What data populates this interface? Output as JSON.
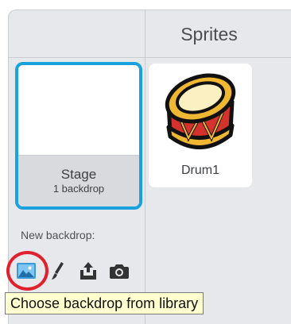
{
  "sprites_panel": {
    "title": "Sprites"
  },
  "stage": {
    "name": "Stage",
    "subtitle": "1 backdrop"
  },
  "new_backdrop": {
    "label": "New backdrop:",
    "tools": [
      {
        "name": "choose-backdrop-from-library",
        "icon": "landscape-icon"
      },
      {
        "name": "paint-new-backdrop",
        "icon": "paintbrush-icon"
      },
      {
        "name": "upload-backdrop-from-file",
        "icon": "upload-icon"
      },
      {
        "name": "new-backdrop-from-camera",
        "icon": "camera-icon"
      }
    ]
  },
  "sprites": [
    {
      "name": "Drum1"
    }
  ],
  "tooltip": {
    "text": "Choose backdrop from library"
  },
  "colors": {
    "accent": "#1aa2de",
    "highlight": "#e1202d",
    "tooltip_bg": "#ffffcf"
  }
}
